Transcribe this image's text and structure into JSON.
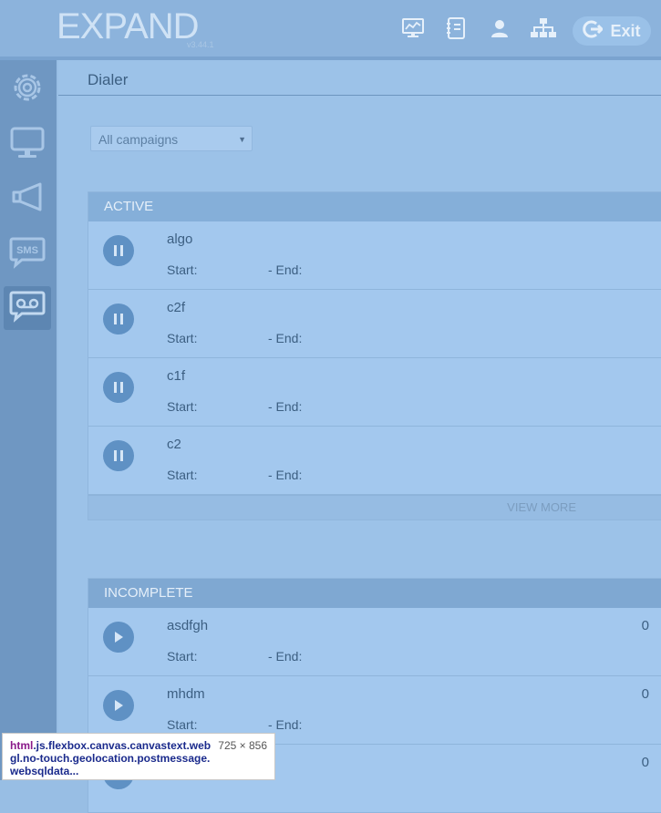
{
  "header": {
    "logo": "EXPAND",
    "version": "v3.44.1",
    "exit_label": "Exit",
    "icons": [
      "monitor-chart-icon",
      "address-book-icon",
      "user-icon",
      "org-chart-icon",
      "exit-icon"
    ]
  },
  "sidebar": {
    "items": [
      {
        "icon": "gear-icon"
      },
      {
        "icon": "monitor-icon"
      },
      {
        "icon": "megaphone-icon"
      },
      {
        "icon": "sms-icon",
        "label": "SMS"
      },
      {
        "icon": "voicemail-icon",
        "active": true
      }
    ]
  },
  "main": {
    "title": "Dialer",
    "campaign_select": {
      "selected": "All campaigns"
    }
  },
  "active": {
    "heading": "ACTIVE",
    "rows": [
      {
        "name": "algo",
        "start": "Start:",
        "end": "- End:"
      },
      {
        "name": "c2f",
        "start": "Start:",
        "end": "- End:"
      },
      {
        "name": "c1f",
        "start": "Start:",
        "end": "- End:"
      },
      {
        "name": "c2",
        "start": "Start:",
        "end": "- End:"
      }
    ],
    "view_more": "VIEW MORE"
  },
  "incomplete": {
    "heading": "INCOMPLETE",
    "rows": [
      {
        "name": "asdfgh",
        "start": "Start:",
        "end": "- End:",
        "count": "0"
      },
      {
        "name": "mhdm",
        "start": "Start:",
        "end": "- End:",
        "count": "0"
      },
      {
        "name": "",
        "start": "",
        "end": "",
        "count": "0"
      }
    ]
  },
  "tooltip": {
    "tag": "html",
    "classes": ".js.flexbox.canvas.canvastext.webgl.no-touch.geolocation.postmessage.websqldata...",
    "dims": "725 × 856"
  },
  "colors": {
    "accent": "#5f91c4",
    "sidebar": "#6f97c2",
    "background": "#98bee4"
  }
}
